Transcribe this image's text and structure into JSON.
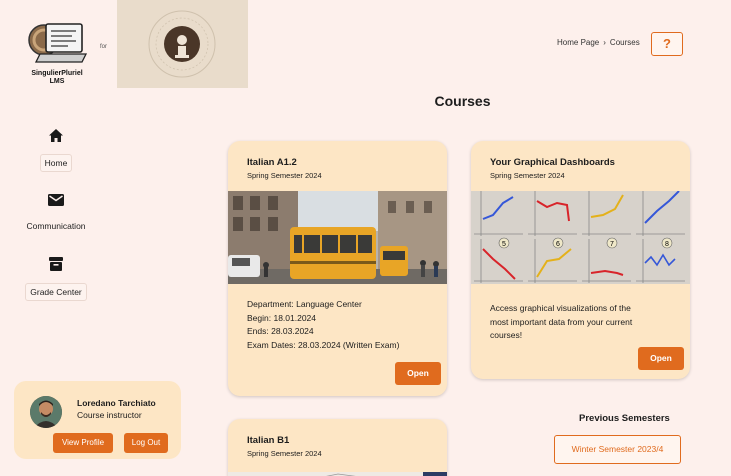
{
  "header": {
    "logo_caption": "SingulierPluriel LMS",
    "for_text": "for",
    "breadcrumb": {
      "home": "Home Page",
      "separator": "›",
      "current": "Courses"
    },
    "help_label": "?"
  },
  "page_title": "Courses",
  "sidebar": {
    "items": [
      {
        "label": "Home",
        "icon": "home-icon"
      },
      {
        "label": "Communication",
        "icon": "mail-icon"
      },
      {
        "label": "Grade Center",
        "icon": "archive-icon"
      }
    ]
  },
  "profile": {
    "name": "Loredano Tarchiato",
    "role": "Course instructor",
    "view_profile_label": "View Profile",
    "log_out_label": "Log Out"
  },
  "courses": [
    {
      "title": "Italian A1.2",
      "semester": "Spring Semester 2024",
      "details": [
        "Department: Language Center",
        "Begin: 18.01.2024",
        "Ends: 28.03.2024",
        "Exam Dates: 28.03.2024 (Written Exam)"
      ],
      "open_label": "Open"
    },
    {
      "title": "Your Graphical Dashboards",
      "semester": "Spring Semester 2024",
      "description": [
        "Access graphical visualizations of the",
        "most important data from your current",
        "courses!"
      ],
      "open_label": "Open",
      "chart_numbers": [
        "5",
        "6",
        "7",
        "8"
      ]
    },
    {
      "title": "Italian B1",
      "semester": "Spring Semester 2024"
    }
  ],
  "previous_semesters": {
    "heading": "Previous Semesters",
    "button_label": "Winter Semester 2023/4"
  },
  "colors": {
    "background": "#fdf0ec",
    "card": "#fde6c5",
    "accent": "#e06b1e",
    "uni_logo_bg": "#e9dccb"
  }
}
